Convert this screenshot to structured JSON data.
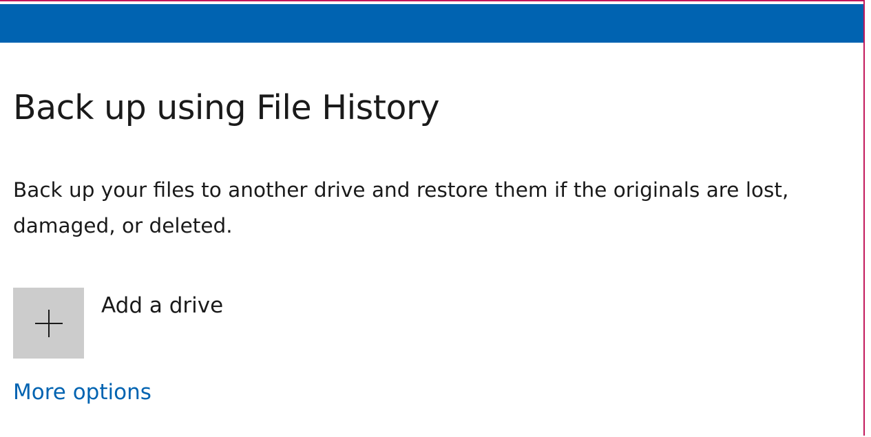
{
  "page": {
    "title": "Back up using File History",
    "description": "Back up your files to another drive and restore them if the originals are lost, damaged, or deleted.",
    "add_drive": {
      "label": "Add a drive",
      "icon": "plus-icon"
    },
    "more_options": "More options"
  },
  "colors": {
    "title_bar": "#0063b1",
    "link": "#0063b1",
    "tile": "#cccccc",
    "window_border": "#c2185b"
  }
}
